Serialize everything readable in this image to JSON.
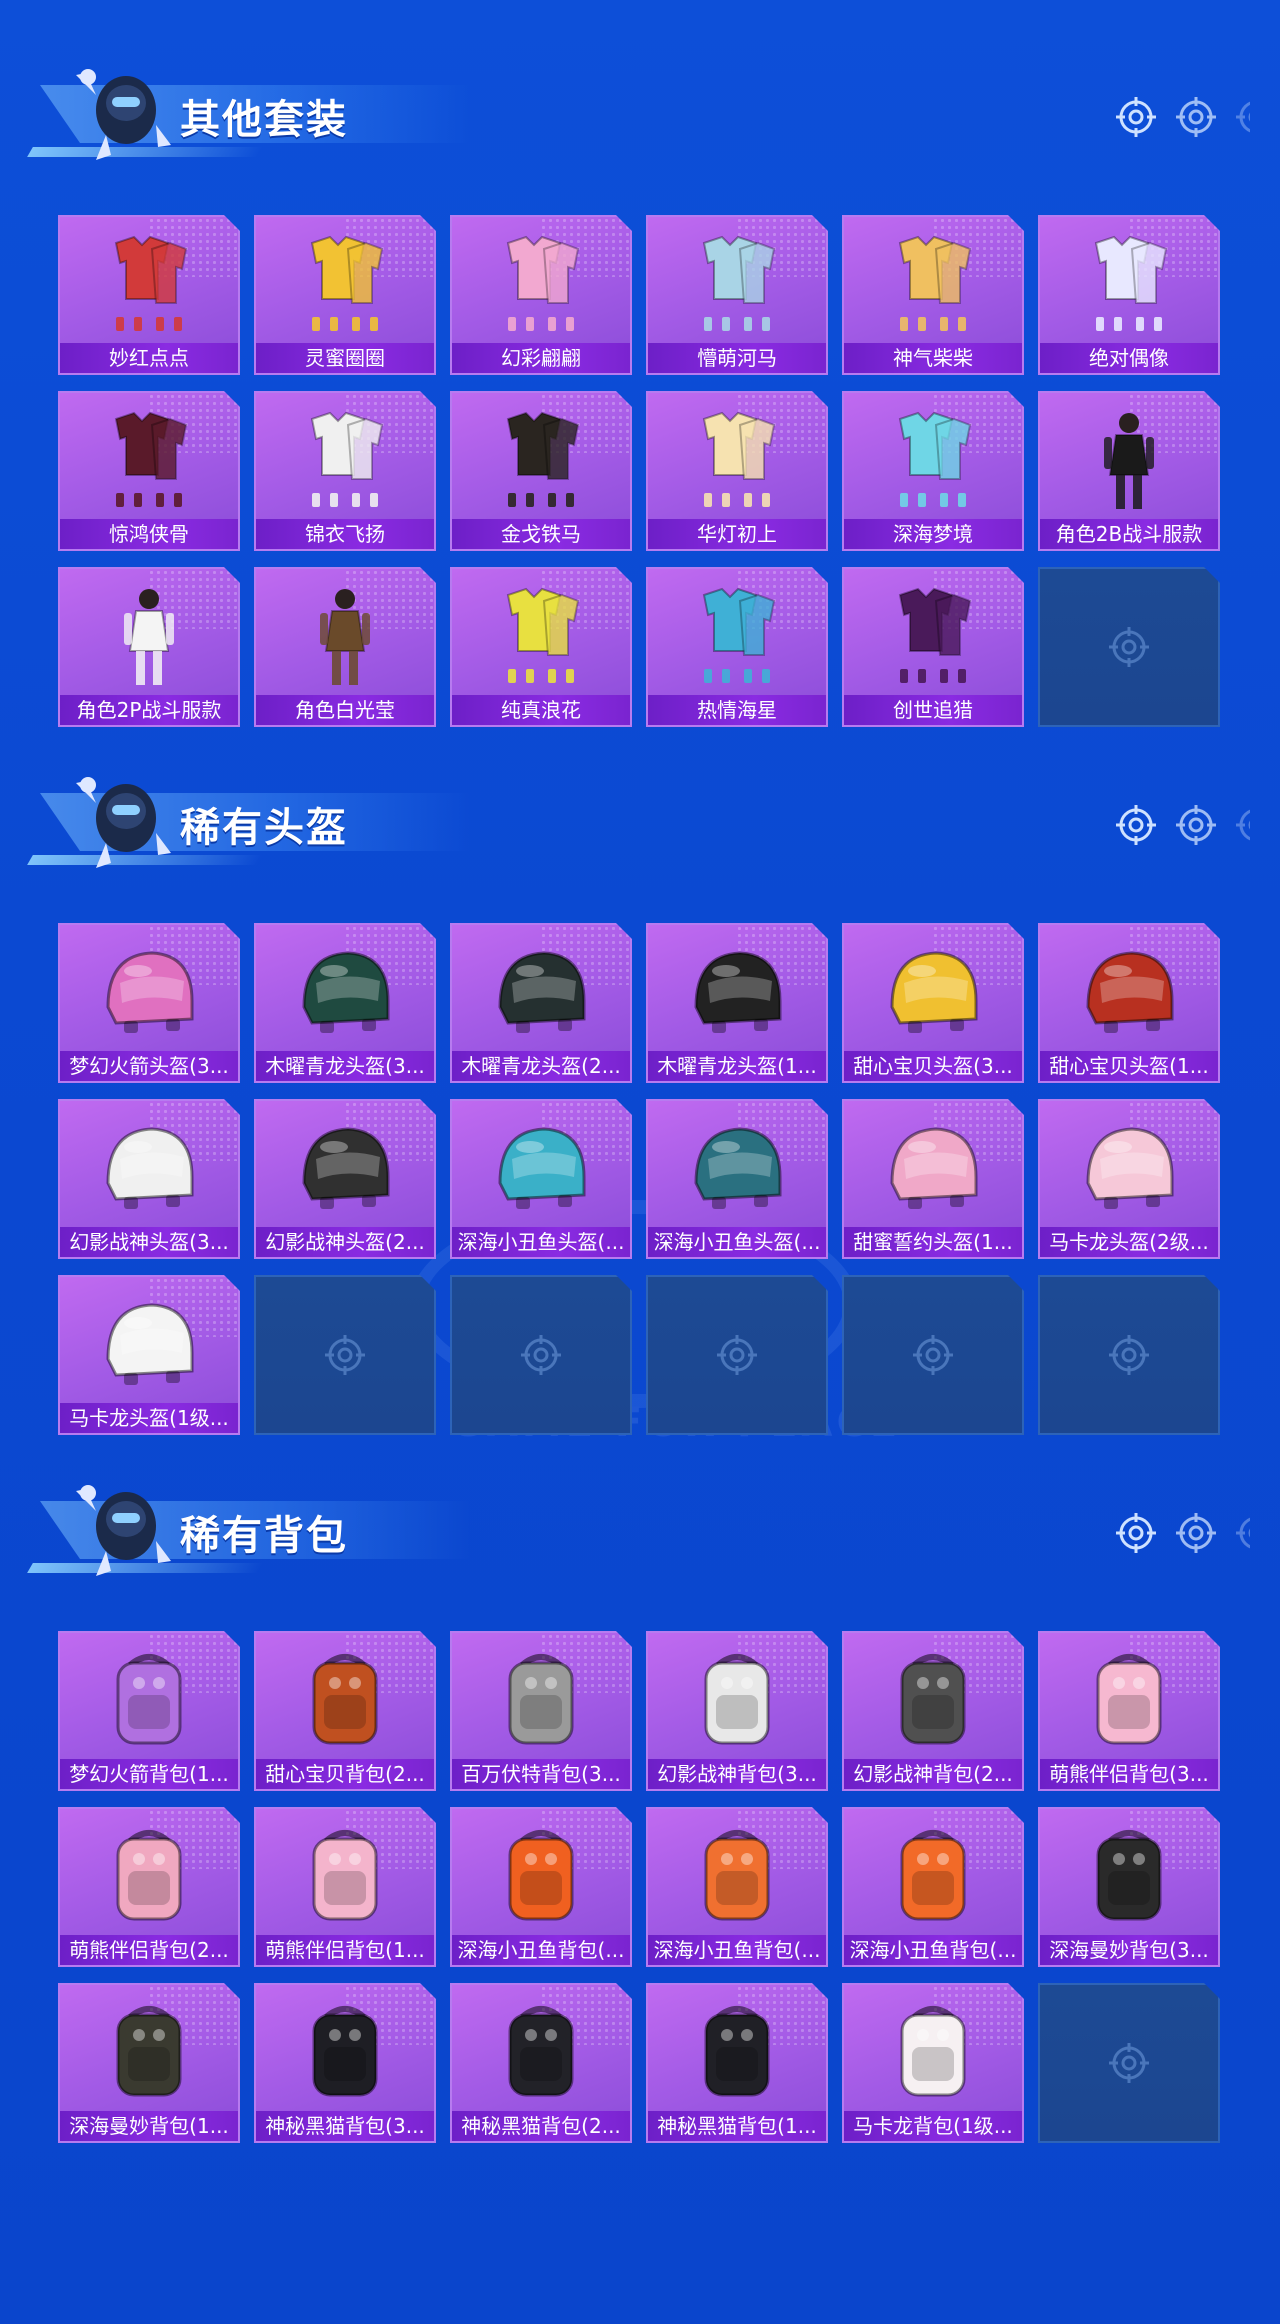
{
  "colors": {
    "background": "#0b49d2",
    "card_purple": "#a35be6",
    "label_bar": "#7a24d0",
    "empty_slot": "#1d4a94",
    "title_text": "#ffffff"
  },
  "watermark": {
    "text": "GAME FOR PEACE"
  },
  "sections": [
    {
      "title": "其他套装",
      "items": [
        {
          "label": "妙红点点",
          "icon": "outfit-red-icon",
          "color": "#d23a3a"
        },
        {
          "label": "灵蜜圈圈",
          "icon": "outfit-yellow-icon",
          "color": "#f2c233"
        },
        {
          "label": "幻彩翩翩",
          "icon": "outfit-pastel-icon",
          "color": "#f2a8d0"
        },
        {
          "label": "懵萌河马",
          "icon": "outfit-hippo-icon",
          "color": "#a9d4e6"
        },
        {
          "label": "神气柴柴",
          "icon": "outfit-shiba-icon",
          "color": "#f0c060"
        },
        {
          "label": "绝对偶像",
          "icon": "outfit-idol-icon",
          "color": "#e8e8ff"
        },
        {
          "label": "惊鸿侠骨",
          "icon": "outfit-hanfu-red-icon",
          "color": "#5a1a2a"
        },
        {
          "label": "锦衣飞扬",
          "icon": "outfit-hanfu-white-icon",
          "color": "#f0f0f0"
        },
        {
          "label": "金戈铁马",
          "icon": "outfit-armor-gold-icon",
          "color": "#2a2520"
        },
        {
          "label": "华灯初上",
          "icon": "outfit-hanfu-cream-icon",
          "color": "#f6e2b0"
        },
        {
          "label": "深海梦境",
          "icon": "outfit-ocean-icon",
          "color": "#6fd6e6"
        },
        {
          "label": "角色2B战斗服款",
          "icon": "character-2b-icon",
          "color": "#1a1a1a"
        },
        {
          "label": "角色2P战斗服款",
          "icon": "character-2p-icon",
          "color": "#f4f4f4"
        },
        {
          "label": "角色白光莹",
          "icon": "character-bai-icon",
          "color": "#6a4a2a"
        },
        {
          "label": "纯真浪花",
          "icon": "outfit-wave-icon",
          "color": "#e8e040"
        },
        {
          "label": "热情海星",
          "icon": "outfit-starfish-icon",
          "color": "#3fb0d6"
        },
        {
          "label": "创世追猎",
          "icon": "outfit-hunter-icon",
          "color": "#4a1a5a"
        },
        {
          "label": "",
          "icon": "empty-slot-icon",
          "empty": true
        }
      ]
    },
    {
      "title": "稀有头盔",
      "items": [
        {
          "label": "梦幻火箭头盔(3...",
          "icon": "helmet-rocket-icon",
          "color": "#e070c0"
        },
        {
          "label": "木曜青龙头盔(3...",
          "icon": "helmet-dragon-icon",
          "color": "#1f4a40"
        },
        {
          "label": "木曜青龙头盔(2...",
          "icon": "helmet-dragon-icon",
          "color": "#253030"
        },
        {
          "label": "木曜青龙头盔(1...",
          "icon": "helmet-dragon-icon",
          "color": "#222222"
        },
        {
          "label": "甜心宝贝头盔(3...",
          "icon": "helmet-sweet-icon",
          "color": "#f0c030"
        },
        {
          "label": "甜心宝贝头盔(1...",
          "icon": "helmet-sweet-icon",
          "color": "#b83020"
        },
        {
          "label": "幻影战神头盔(3...",
          "icon": "helmet-phantom-icon",
          "color": "#f0f0f0"
        },
        {
          "label": "幻影战神头盔(2...",
          "icon": "helmet-phantom-icon",
          "color": "#303030"
        },
        {
          "label": "深海小丑鱼头盔(...",
          "icon": "helmet-clownfish-icon",
          "color": "#3ab0c8"
        },
        {
          "label": "深海小丑鱼头盔(...",
          "icon": "helmet-clownfish-icon",
          "color": "#2a7080"
        },
        {
          "label": "甜蜜誓约头盔(1...",
          "icon": "helmet-vow-icon",
          "color": "#f0a8c8"
        },
        {
          "label": "马卡龙头盔(2级...",
          "icon": "helmet-macaron-icon",
          "color": "#f6c8d8"
        },
        {
          "label": "马卡龙头盔(1级...",
          "icon": "helmet-macaron-icon",
          "color": "#f4f4f4"
        },
        {
          "label": "",
          "icon": "empty-slot-icon",
          "empty": true
        },
        {
          "label": "",
          "icon": "empty-slot-icon",
          "empty": true
        },
        {
          "label": "",
          "icon": "empty-slot-icon",
          "empty": true
        },
        {
          "label": "",
          "icon": "empty-slot-icon",
          "empty": true
        },
        {
          "label": "",
          "icon": "empty-slot-icon",
          "empty": true
        }
      ]
    },
    {
      "title": "稀有背包",
      "items": [
        {
          "label": "梦幻火箭背包(1...",
          "icon": "backpack-rocket-icon",
          "color": "#b070e0"
        },
        {
          "label": "甜心宝贝背包(2...",
          "icon": "backpack-sweet-icon",
          "color": "#c05020"
        },
        {
          "label": "百万伏特背包(3...",
          "icon": "backpack-volt-icon",
          "color": "#9a9a9a"
        },
        {
          "label": "幻影战神背包(3...",
          "icon": "backpack-phantom-icon",
          "color": "#e8e8e8"
        },
        {
          "label": "幻影战神背包(2...",
          "icon": "backpack-phantom-icon",
          "color": "#505050"
        },
        {
          "label": "萌熊伴侣背包(3...",
          "icon": "backpack-bear-icon",
          "color": "#f6b8d0"
        },
        {
          "label": "萌熊伴侣背包(2...",
          "icon": "backpack-bear-icon",
          "color": "#f0a8c0"
        },
        {
          "label": "萌熊伴侣背包(1...",
          "icon": "backpack-bear-icon",
          "color": "#f4b4cc"
        },
        {
          "label": "深海小丑鱼背包(...",
          "icon": "backpack-clownfish-icon",
          "color": "#f06020"
        },
        {
          "label": "深海小丑鱼背包(...",
          "icon": "backpack-clownfish-icon",
          "color": "#f07030"
        },
        {
          "label": "深海小丑鱼背包(...",
          "icon": "backpack-clownfish-icon",
          "color": "#f26a28"
        },
        {
          "label": "深海曼妙背包(3...",
          "icon": "backpack-scuba-icon",
          "color": "#2a2a2a"
        },
        {
          "label": "深海曼妙背包(1...",
          "icon": "backpack-scuba-icon",
          "color": "#3a3a30"
        },
        {
          "label": "神秘黑猫背包(3...",
          "icon": "backpack-cat-icon",
          "color": "#1e1e24"
        },
        {
          "label": "神秘黑猫背包(2...",
          "icon": "backpack-cat-icon",
          "color": "#222228"
        },
        {
          "label": "神秘黑猫背包(1...",
          "icon": "backpack-cat-icon",
          "color": "#202026"
        },
        {
          "label": "马卡龙背包(1级...",
          "icon": "backpack-macaron-icon",
          "color": "#f6f0f2"
        },
        {
          "label": "",
          "icon": "empty-slot-icon",
          "empty": true
        }
      ]
    }
  ]
}
